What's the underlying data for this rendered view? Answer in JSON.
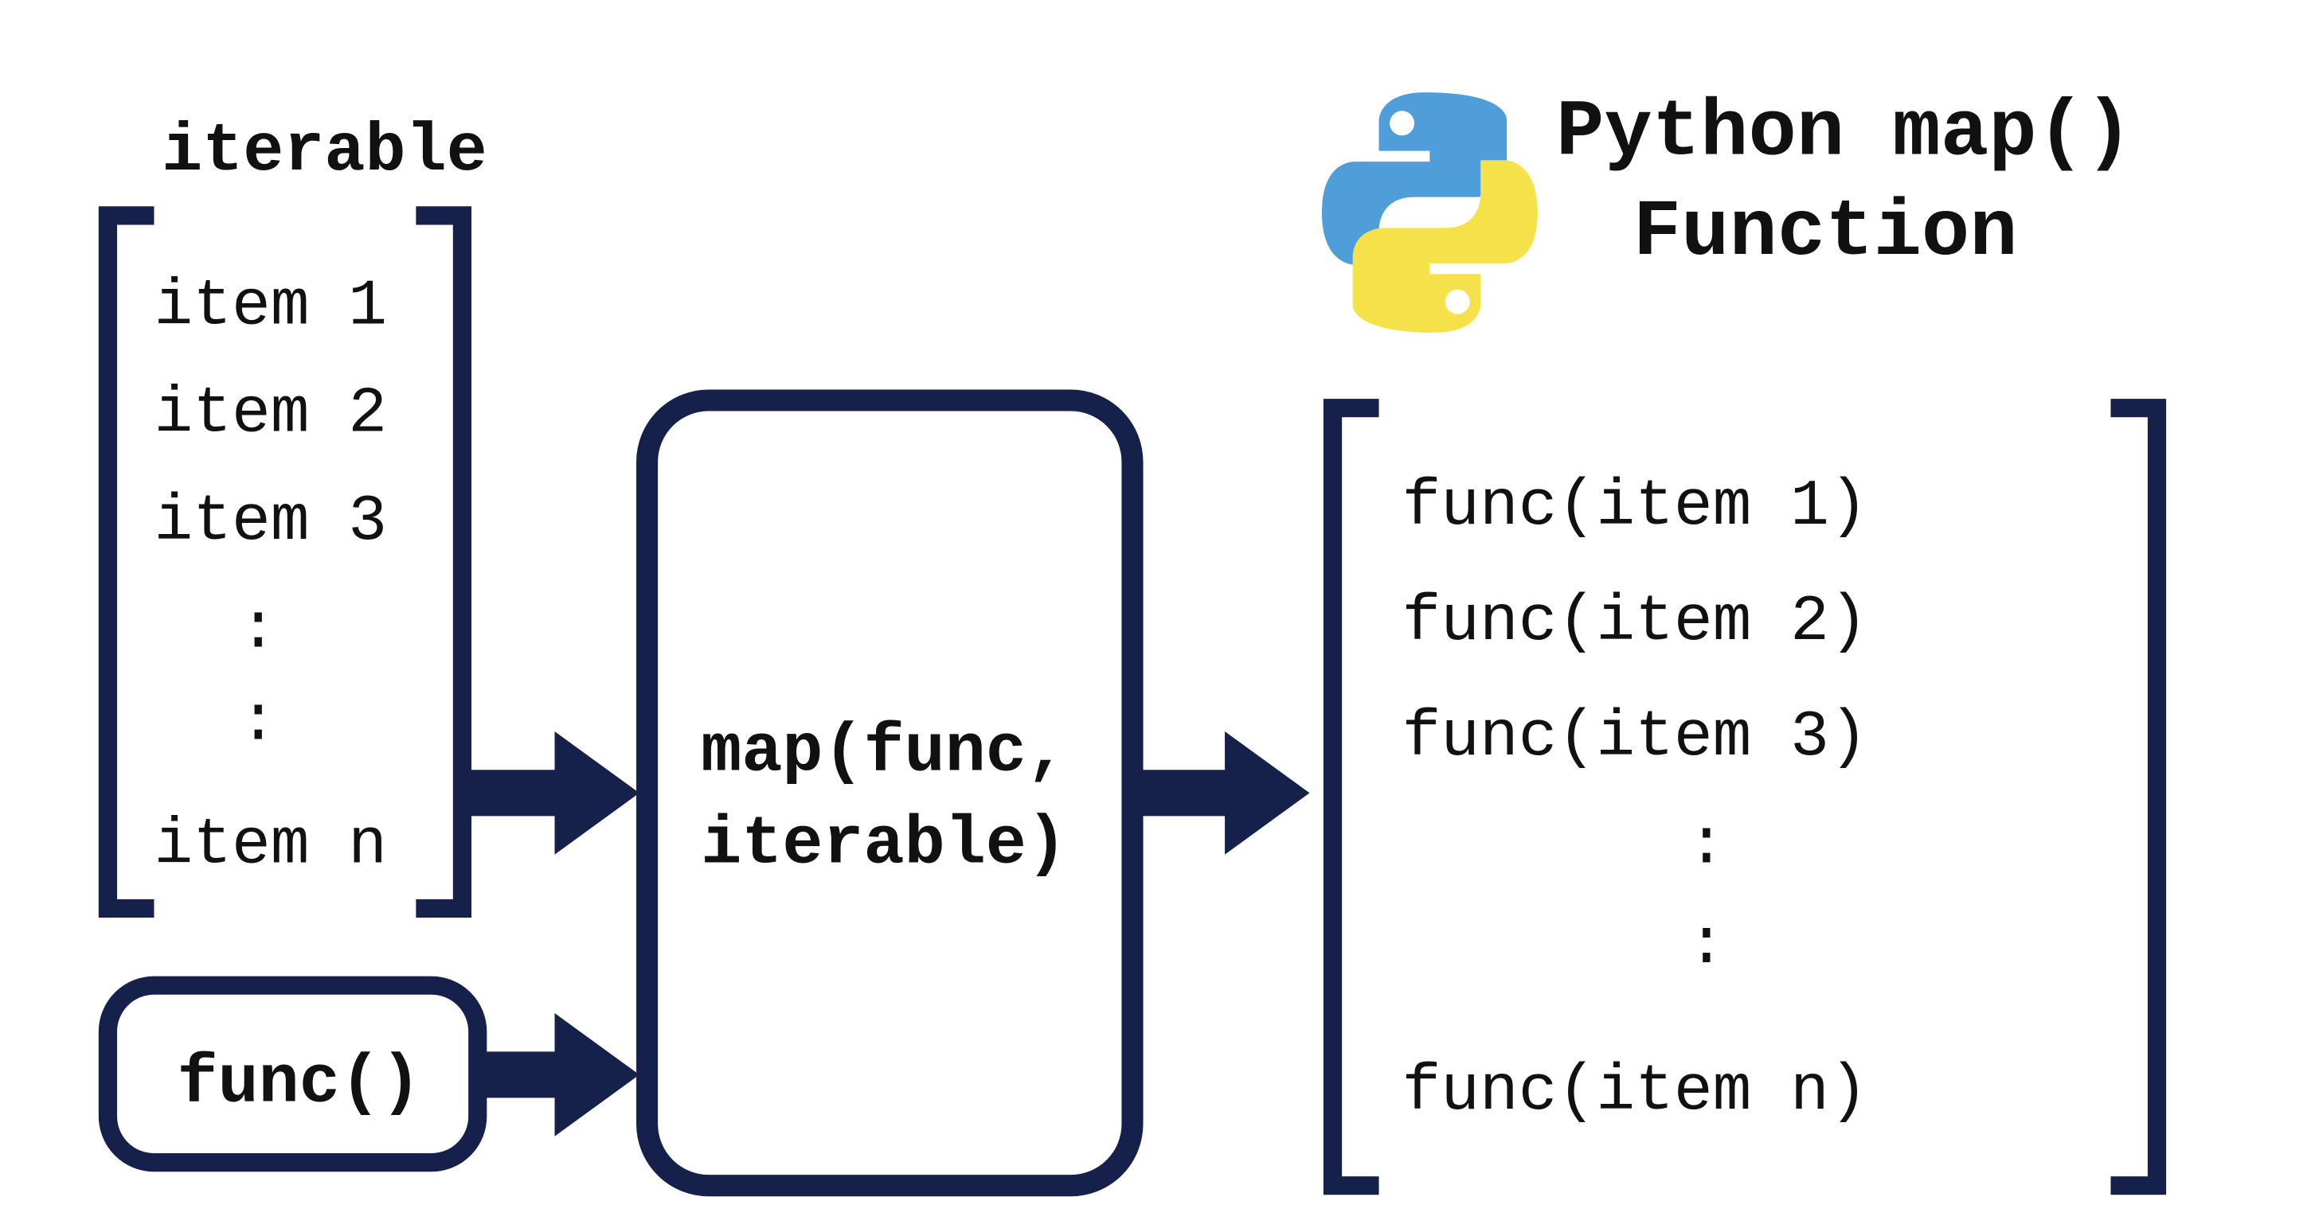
{
  "title": {
    "line1": "Python map()",
    "line2": "Function"
  },
  "iterable_label": "iterable",
  "iterable_items": [
    "item 1",
    "item 2",
    "item 3",
    ":",
    ":",
    "item n"
  ],
  "func_label": "func()",
  "map_label": {
    "line1": "map(func,",
    "line2": "iterable)"
  },
  "output_items": [
    "func(item 1)",
    "func(item 2)",
    "func(item 3)",
    ":",
    ":",
    "func(item n)"
  ],
  "colors": {
    "ink": "#15214a",
    "py_blue": "#4f9dd9",
    "py_yellow": "#f5e24a",
    "text": "#111111"
  }
}
